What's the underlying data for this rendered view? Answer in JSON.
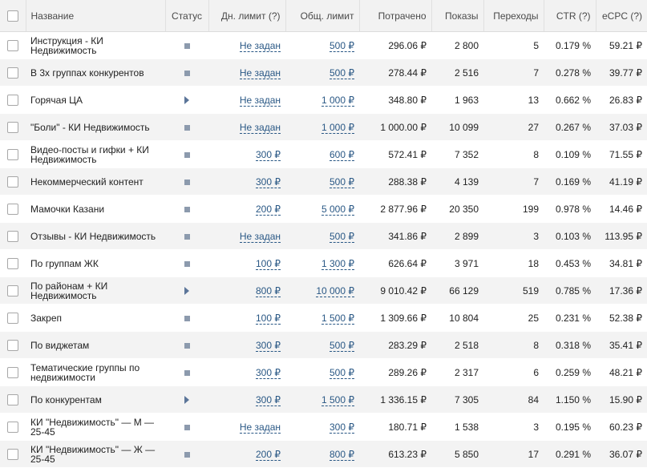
{
  "headers": {
    "name": "Название",
    "status": "Статус",
    "daily_limit": "Дн. лимит (?)",
    "total_limit": "Общ. лимит",
    "spent": "Потрачено",
    "impressions": "Показы",
    "clicks": "Переходы",
    "ctr": "CTR (?)",
    "ecpc": "eCPC (?)"
  },
  "status_icons": {
    "stopped": "stop-icon",
    "running": "play-icon"
  },
  "rows": [
    {
      "name": "Инструкция - КИ Недвижимость",
      "status": "stopped",
      "daily_limit": "Не задан",
      "total_limit": "500 ₽",
      "spent": "296.06 ₽",
      "impressions": "2 800",
      "clicks": "5",
      "ctr": "0.179 %",
      "ecpc": "59.21 ₽"
    },
    {
      "name": "В 3х группах конкурентов",
      "status": "stopped",
      "daily_limit": "Не задан",
      "total_limit": "500 ₽",
      "spent": "278.44 ₽",
      "impressions": "2 516",
      "clicks": "7",
      "ctr": "0.278 %",
      "ecpc": "39.77 ₽"
    },
    {
      "name": "Горячая ЦА",
      "status": "running",
      "daily_limit": "Не задан",
      "total_limit": "1 000 ₽",
      "spent": "348.80 ₽",
      "impressions": "1 963",
      "clicks": "13",
      "ctr": "0.662 %",
      "ecpc": "26.83 ₽"
    },
    {
      "name": "\"Боли\" - КИ Недвижимость",
      "status": "stopped",
      "daily_limit": "Не задан",
      "total_limit": "1 000 ₽",
      "spent": "1 000.00 ₽",
      "impressions": "10 099",
      "clicks": "27",
      "ctr": "0.267 %",
      "ecpc": "37.03 ₽"
    },
    {
      "name": "Видео-посты и гифки + КИ Недвижимость",
      "status": "stopped",
      "daily_limit": "300 ₽",
      "total_limit": "600 ₽",
      "spent": "572.41 ₽",
      "impressions": "7 352",
      "clicks": "8",
      "ctr": "0.109 %",
      "ecpc": "71.55 ₽"
    },
    {
      "name": "Некоммерческий контент",
      "status": "stopped",
      "daily_limit": "300 ₽",
      "total_limit": "500 ₽",
      "spent": "288.38 ₽",
      "impressions": "4 139",
      "clicks": "7",
      "ctr": "0.169 %",
      "ecpc": "41.19 ₽"
    },
    {
      "name": "Мамочки Казани",
      "status": "stopped",
      "daily_limit": "200 ₽",
      "total_limit": "5 000 ₽",
      "spent": "2 877.96 ₽",
      "impressions": "20 350",
      "clicks": "199",
      "ctr": "0.978 %",
      "ecpc": "14.46 ₽"
    },
    {
      "name": "Отзывы - КИ Недвижимость",
      "status": "stopped",
      "daily_limit": "Не задан",
      "total_limit": "500 ₽",
      "spent": "341.86 ₽",
      "impressions": "2 899",
      "clicks": "3",
      "ctr": "0.103 %",
      "ecpc": "113.95 ₽"
    },
    {
      "name": "По группам ЖК",
      "status": "stopped",
      "daily_limit": "100 ₽",
      "total_limit": "1 300 ₽",
      "spent": "626.64 ₽",
      "impressions": "3 971",
      "clicks": "18",
      "ctr": "0.453 %",
      "ecpc": "34.81 ₽"
    },
    {
      "name": "По районам + КИ Недвижимость",
      "status": "running",
      "daily_limit": "800 ₽",
      "total_limit": "10 000 ₽",
      "spent": "9 010.42 ₽",
      "impressions": "66 129",
      "clicks": "519",
      "ctr": "0.785 %",
      "ecpc": "17.36 ₽"
    },
    {
      "name": "Закреп",
      "status": "stopped",
      "daily_limit": "100 ₽",
      "total_limit": "1 500 ₽",
      "spent": "1 309.66 ₽",
      "impressions": "10 804",
      "clicks": "25",
      "ctr": "0.231 %",
      "ecpc": "52.38 ₽"
    },
    {
      "name": "По виджетам",
      "status": "stopped",
      "daily_limit": "300 ₽",
      "total_limit": "500 ₽",
      "spent": "283.29 ₽",
      "impressions": "2 518",
      "clicks": "8",
      "ctr": "0.318 %",
      "ecpc": "35.41 ₽"
    },
    {
      "name": "Тематические группы по недвижимости",
      "status": "stopped",
      "daily_limit": "300 ₽",
      "total_limit": "500 ₽",
      "spent": "289.26 ₽",
      "impressions": "2 317",
      "clicks": "6",
      "ctr": "0.259 %",
      "ecpc": "48.21 ₽"
    },
    {
      "name": "По конкурентам",
      "status": "running",
      "daily_limit": "300 ₽",
      "total_limit": "1 500 ₽",
      "spent": "1 336.15 ₽",
      "impressions": "7 305",
      "clicks": "84",
      "ctr": "1.150 %",
      "ecpc": "15.90 ₽"
    },
    {
      "name": "КИ \"Недвижимость\" — М — 25-45",
      "status": "stopped",
      "daily_limit": "Не задан",
      "total_limit": "300 ₽",
      "spent": "180.71 ₽",
      "impressions": "1 538",
      "clicks": "3",
      "ctr": "0.195 %",
      "ecpc": "60.23 ₽"
    },
    {
      "name": "КИ \"Недвижимость\" — Ж — 25-45",
      "status": "stopped",
      "daily_limit": "200 ₽",
      "total_limit": "800 ₽",
      "spent": "613.23 ₽",
      "impressions": "5 850",
      "clicks": "17",
      "ctr": "0.291 %",
      "ecpc": "36.07 ₽"
    }
  ]
}
